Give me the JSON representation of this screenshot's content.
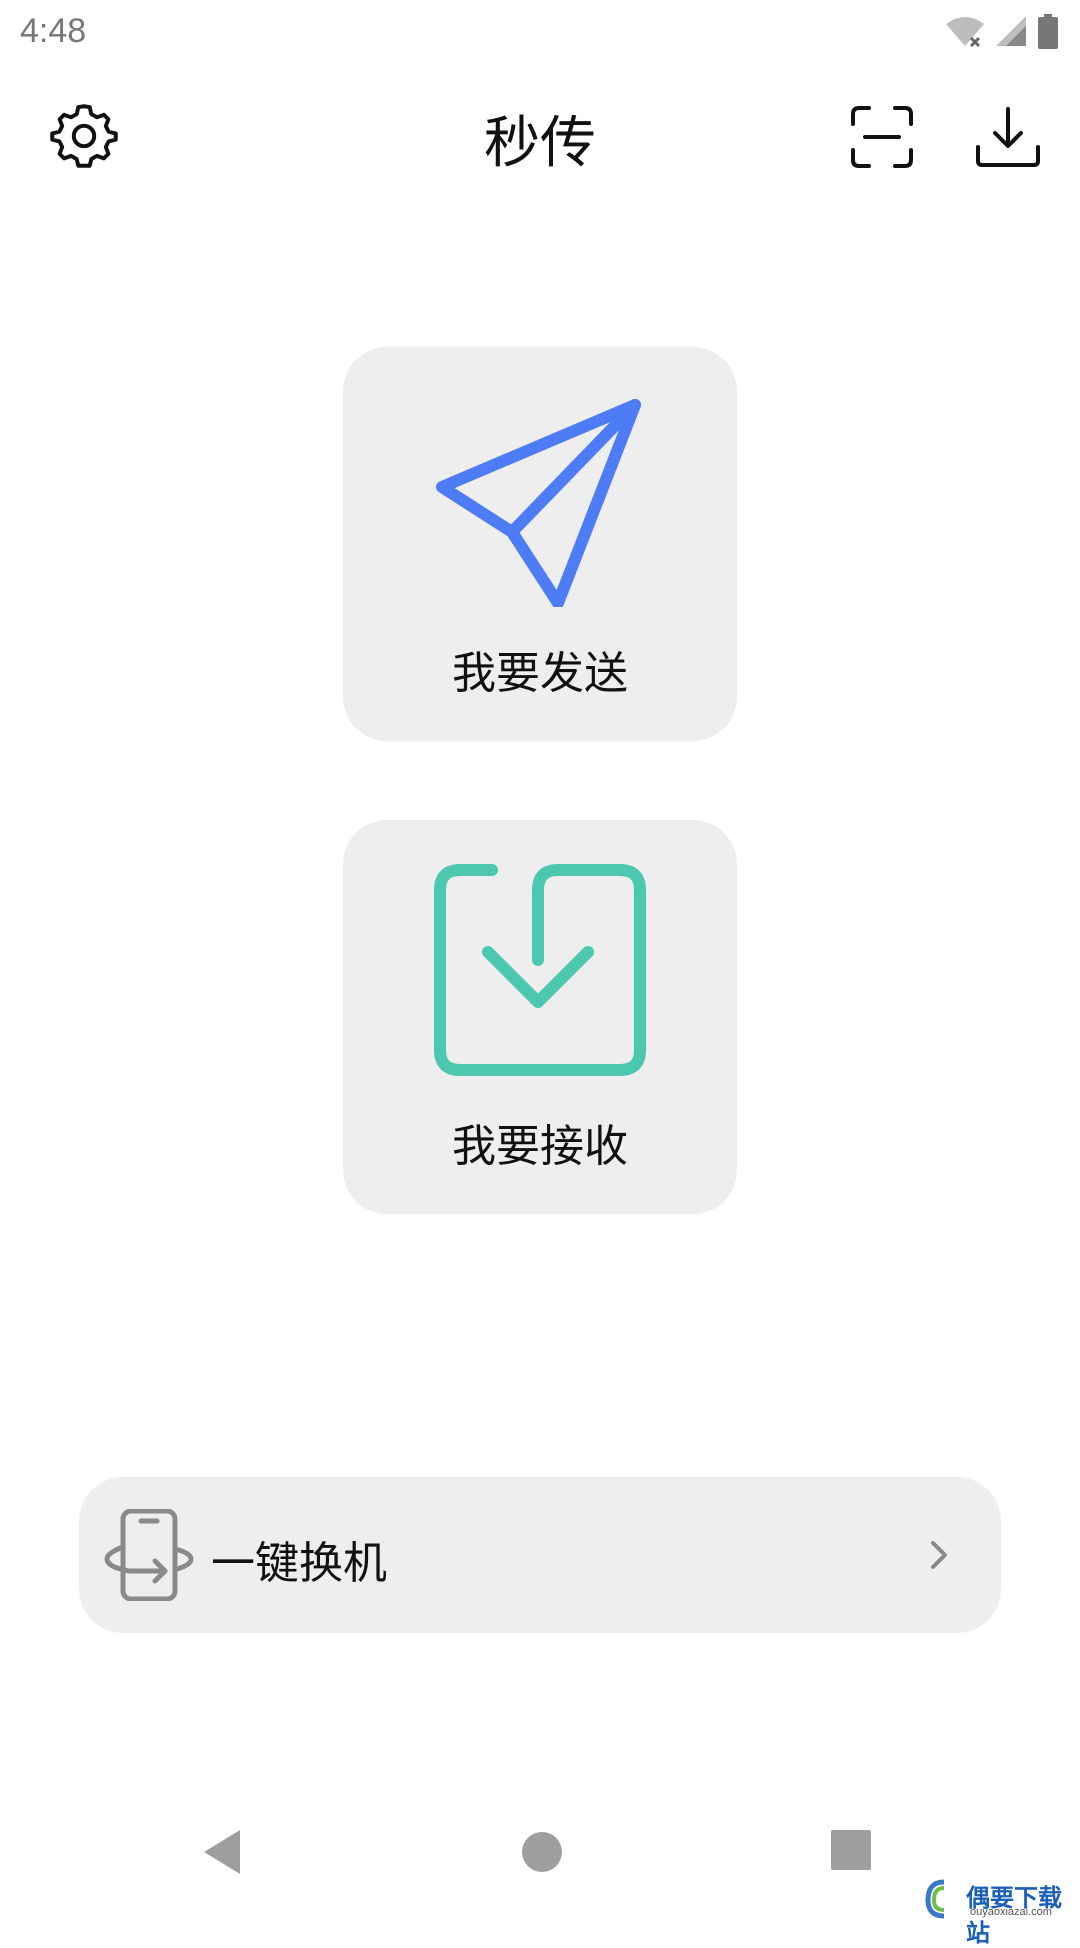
{
  "status_bar": {
    "time": "4:48",
    "icons": [
      "wifi-off-icon",
      "signal-icon",
      "battery-icon"
    ]
  },
  "app_bar": {
    "title": "秒传",
    "icons": [
      "gear-icon",
      "scan-icon",
      "download-icon"
    ]
  },
  "cards": {
    "send": {
      "label": "我要发送",
      "icon": "paper-plane-icon",
      "color": "#4e7cf6"
    },
    "receive": {
      "label": "我要接收",
      "icon": "inbox-download-icon",
      "color": "#4cc8b0"
    }
  },
  "switch_phone": {
    "label": "一键换机",
    "icon": "phone-swap-icon"
  },
  "nav_bar": {
    "icons": [
      "back-triangle-icon",
      "home-circle-icon",
      "recent-square-icon"
    ]
  },
  "watermark": {
    "title": "偶要下载站",
    "subtitle": "ouyaoxiazai.com"
  },
  "colors": {
    "card_background": "#eeeeee",
    "send_accent": "#4e7cf6",
    "receive_accent": "#4cc8b0",
    "nav_icon": "#9e9e9e"
  }
}
